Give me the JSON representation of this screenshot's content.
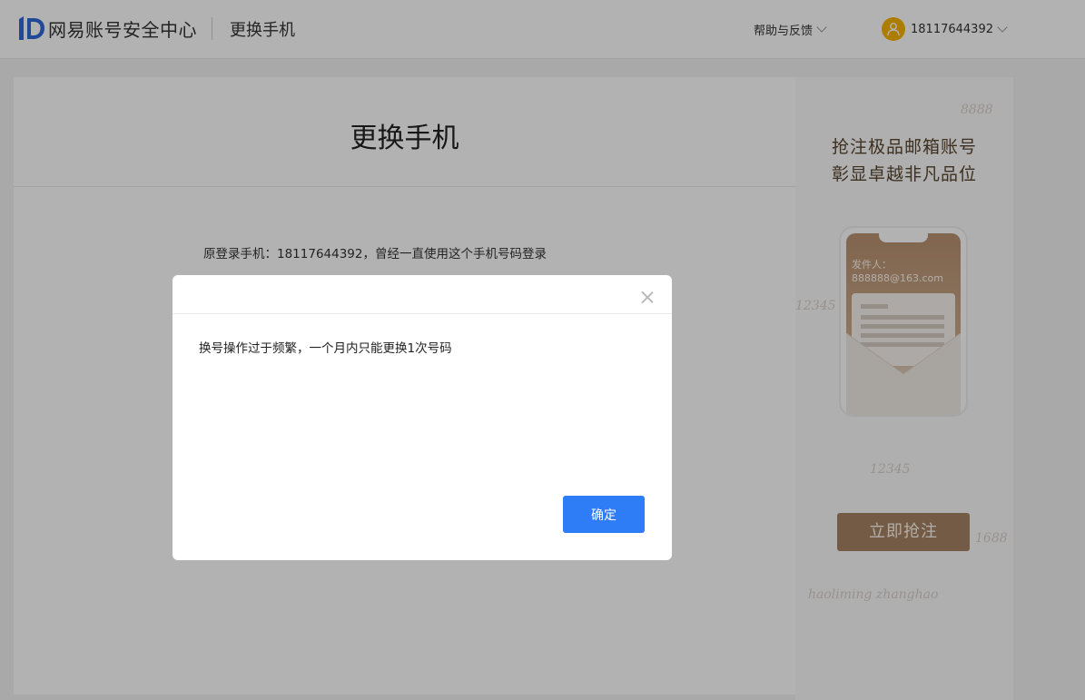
{
  "header": {
    "logo_text": "网易账号安全中心",
    "page_title": "更换手机",
    "help_label": "帮助与反馈",
    "username": "18117644392"
  },
  "main": {
    "title": "更换手机",
    "old_phone_text": "原登录手机：18117644392，曾经一直使用这个手机号码登录"
  },
  "ad": {
    "line1": "抢注极品邮箱账号",
    "line2": "彰显卓越非凡品位",
    "sender_label": "发件人：",
    "sender_email": "888888@163.com",
    "button_label": "立即抢注",
    "deco_1": "8888",
    "deco_2": "12345",
    "deco_3": "12345",
    "deco_4": "1688",
    "deco_5": "haoliming zhanghao"
  },
  "dialog": {
    "message": "换号操作过于频繁，一个月内只能更换1次号码",
    "confirm_label": "确定"
  },
  "colors": {
    "primary": "#2e7cf6",
    "logo_blue": "#2f6bd8",
    "ad_brown": "#a58363",
    "avatar_yellow": "#f6b400"
  }
}
